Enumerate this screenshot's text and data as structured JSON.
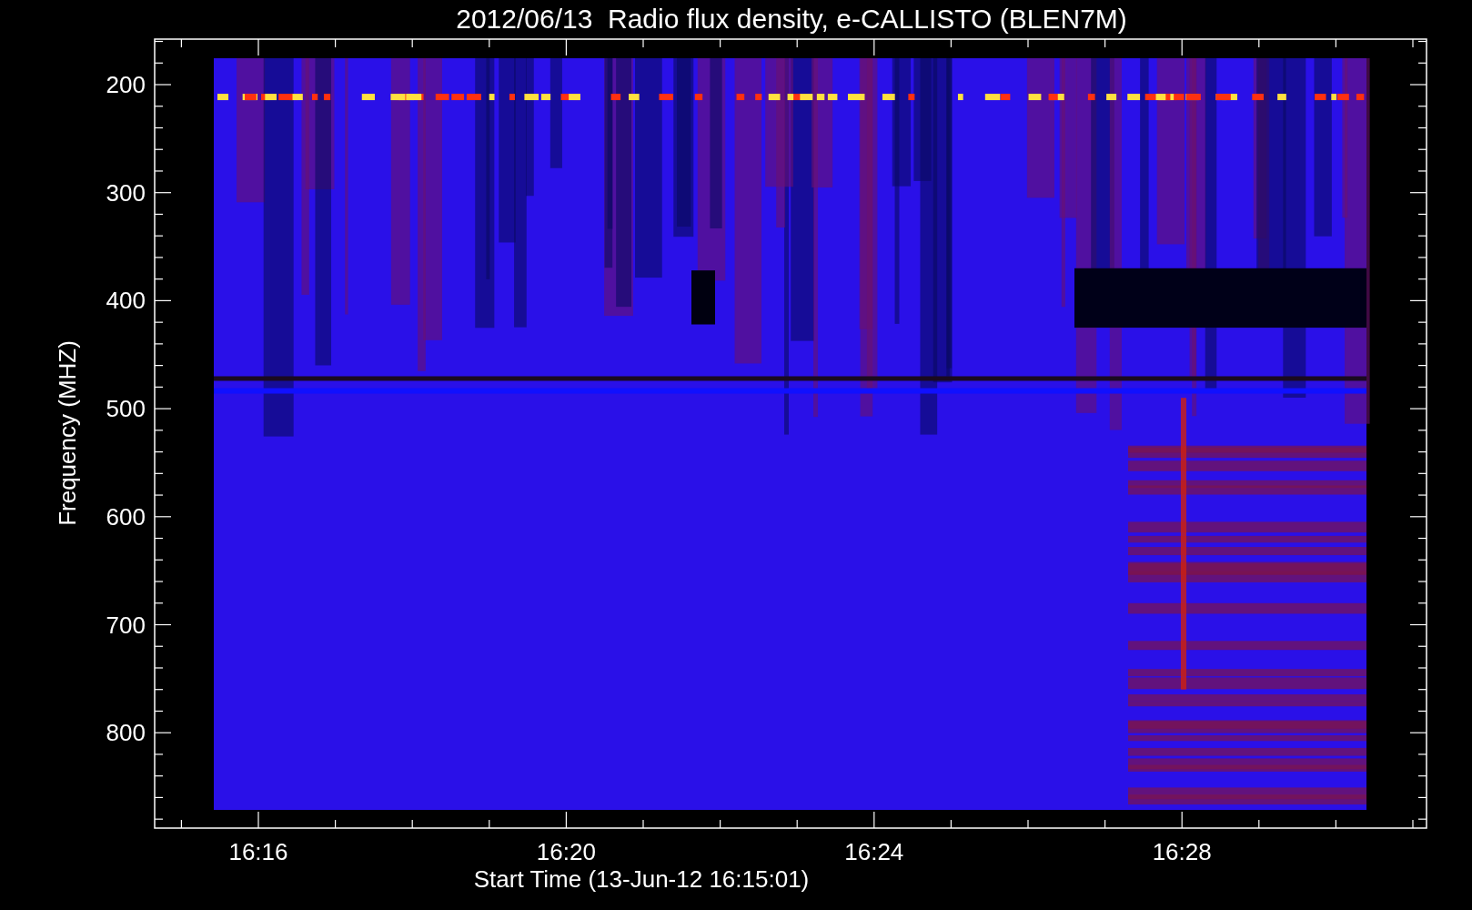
{
  "title": "2012/06/13  Radio flux density, e-CALLISTO (BLEN7M)",
  "y_axis": {
    "label": "Frequency (MHZ)",
    "tick_labels": [
      "200",
      "300",
      "400",
      "500",
      "600",
      "700",
      "800"
    ]
  },
  "x_axis": {
    "label": "Start Time (13-Jun-12 16:15:01)",
    "tick_labels": [
      "16:16",
      "16:20",
      "16:24",
      "16:28"
    ]
  }
}
